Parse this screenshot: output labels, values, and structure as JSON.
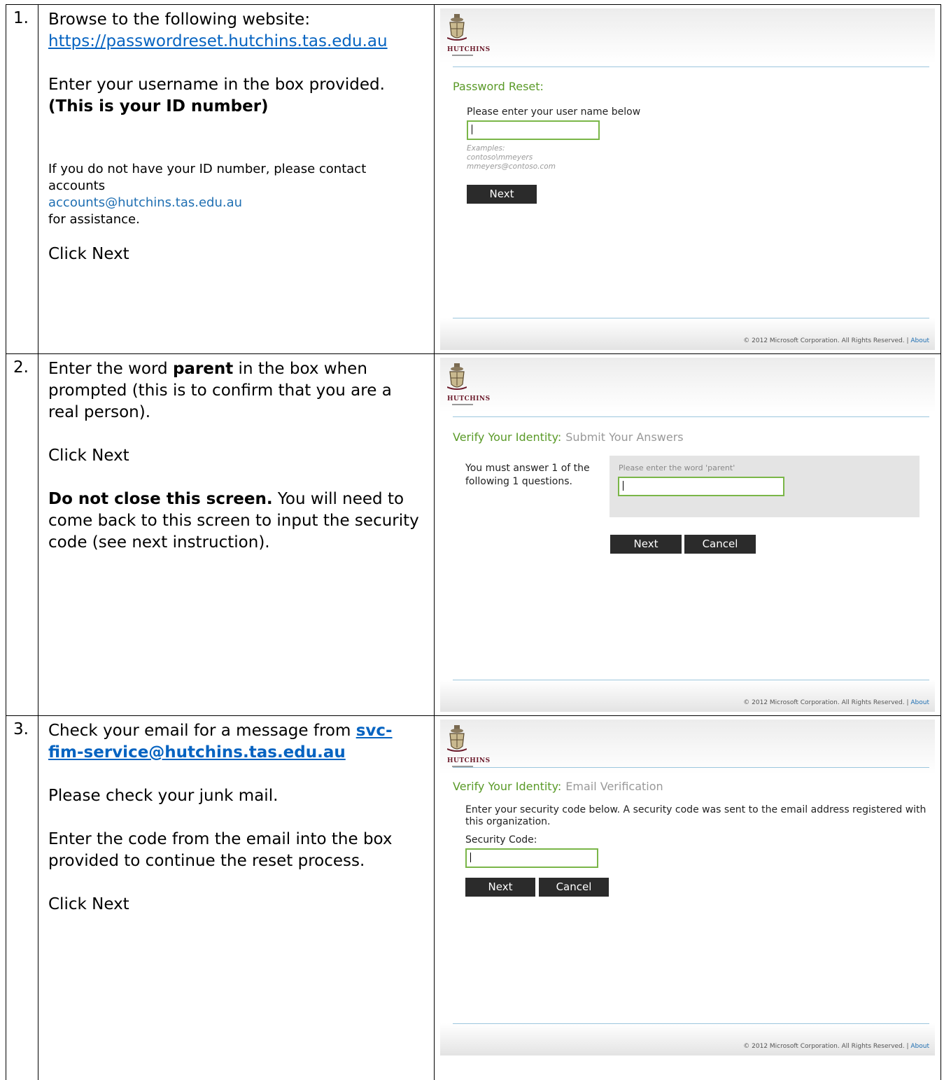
{
  "steps": [
    {
      "number": "1.",
      "line1": "Browse to the following website:",
      "link": "https://passwordreset.hutchins.tas.edu.au",
      "line2": "Enter your username in the box provided.",
      "line2_bold": "(This is your ID number)",
      "small_before": "If you do not have your ID number, please contact accounts ",
      "small_email": "accounts@hutchins.tas.edu.au",
      "small_after": "for assistance.",
      "action": "Click Next"
    },
    {
      "number": "2.",
      "line1_pre": "Enter the word ",
      "line1_bold": "parent",
      "line1_post": " in the box when prompted (this is to confirm that you are a real person).",
      "action": "Click Next",
      "warn_bold": "Do not close this screen.",
      "warn_rest": "  You will need to come back to this screen to input the security code (see next instruction)."
    },
    {
      "number": "3.",
      "line1": "Check your email for a message from ",
      "email_link_a": "svc-",
      "email_link_b": "fim-service@hutchins.tas.edu.au",
      "junk": "Please check your junk mail.",
      "enter_code": "Enter the code from the email into the box provided to continue the reset process.",
      "action": "Click Next"
    }
  ],
  "screens": {
    "logo_text": "HUTCHINS",
    "footer_text": "© 2012 Microsoft Corporation. All Rights Reserved.  |  ",
    "footer_about": "About",
    "screen1": {
      "heading": "Password Reset:",
      "prompt": "Please enter your user name below",
      "examples_title": "Examples:",
      "example1": "contoso\\mmeyers",
      "example2": "mmeyers@contoso.com",
      "next": "Next"
    },
    "screen2": {
      "heading": "Verify Your Identity:",
      "heading_sub": "Submit Your Answers",
      "instruction_l1": "You must answer 1 of the",
      "instruction_l2": "following 1 questions.",
      "question": "Please enter the word 'parent'",
      "next": "Next",
      "cancel": "Cancel"
    },
    "screen3": {
      "heading": "Verify Your Identity:",
      "heading_sub": "Email Verification",
      "instruction_l1": "Enter your security code below. A security code was sent to the email address registered with",
      "instruction_l2": "this organization.",
      "code_label": "Security Code:",
      "next": "Next",
      "cancel": "Cancel"
    }
  }
}
